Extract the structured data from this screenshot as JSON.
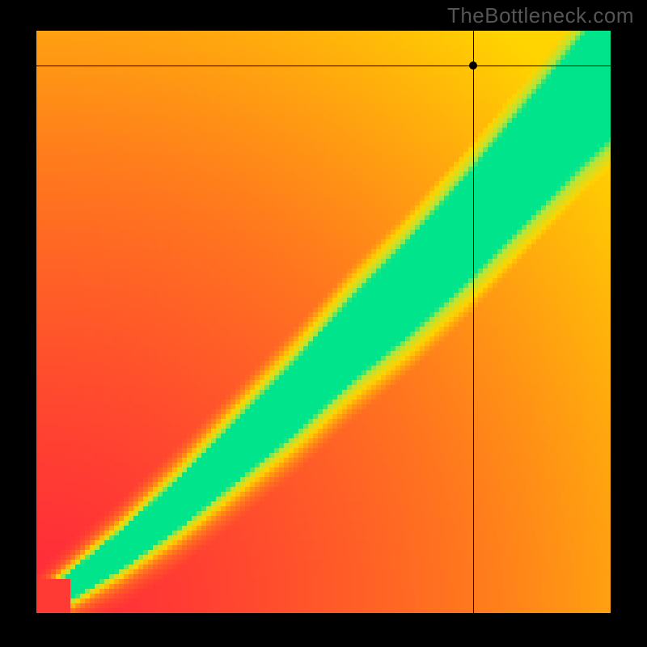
{
  "watermark": "TheBottleneck.com",
  "chart_data": {
    "type": "heatmap",
    "title": "",
    "xlabel": "",
    "ylabel": "",
    "xlim": [
      0,
      1
    ],
    "ylim": [
      0,
      1
    ],
    "ideal_curve": {
      "description": "Green balanced-performance ridge; approximate (x_norm, y_norm) samples, origin at lower-left",
      "points": [
        [
          0.05,
          0.04
        ],
        [
          0.15,
          0.11
        ],
        [
          0.25,
          0.19
        ],
        [
          0.35,
          0.28
        ],
        [
          0.45,
          0.37
        ],
        [
          0.55,
          0.47
        ],
        [
          0.65,
          0.56
        ],
        [
          0.75,
          0.66
        ],
        [
          0.85,
          0.77
        ],
        [
          0.95,
          0.88
        ],
        [
          1.0,
          0.93
        ]
      ]
    },
    "marker": {
      "description": "Black crosshair & dot; (x_norm, y_norm) origin at lower-left",
      "x": 0.76,
      "y": 0.94
    },
    "color_scale": {
      "low": "#ff2a3a",
      "mid": "#ffd400",
      "high": "#00e58c",
      "meaning": "high = balanced, low = bottlenecked"
    }
  }
}
